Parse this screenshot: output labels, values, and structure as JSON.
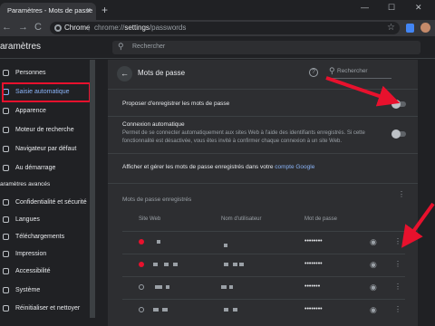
{
  "browser": {
    "tab_title": "Paramètres - Mots de passe",
    "tab_close": "×",
    "new_tab": "+",
    "win_min": "—",
    "win_max": "☐",
    "win_close": "✕",
    "omnibox_site": "Chrome",
    "omnibox_sep": "|",
    "omnibox_url_prefix": "chrome://",
    "omnibox_url_path": "settings",
    "omnibox_url_suffix": "/passwords",
    "back": "←",
    "forward": "→",
    "reload": "C",
    "star": "☆"
  },
  "header": {
    "title": "aramètres",
    "search_placeholder": "Rechercher"
  },
  "sidebar": {
    "items": [
      {
        "label": "Personnes",
        "icon": "person-icon"
      },
      {
        "label": "Saisie automatique",
        "icon": "autofill-icon",
        "active": true
      },
      {
        "label": "Apparence",
        "icon": "palette-icon"
      },
      {
        "label": "Moteur de recherche",
        "icon": "search-engine-icon"
      },
      {
        "label": "Navigateur par défaut",
        "icon": "browser-icon"
      },
      {
        "label": "Au démarrage",
        "icon": "power-icon"
      }
    ],
    "section_label": "aramètres avancés",
    "advanced_items": [
      {
        "label": "Confidentialité et sécurité",
        "icon": "shield-icon"
      },
      {
        "label": "Langues",
        "icon": "globe-icon"
      },
      {
        "label": "Téléchargements",
        "icon": "download-icon"
      },
      {
        "label": "Impression",
        "icon": "printer-icon"
      },
      {
        "label": "Accessibilité",
        "icon": "accessibility-icon"
      },
      {
        "label": "Système",
        "icon": "wrench-icon"
      },
      {
        "label": "Réinitialiser et nettoyer",
        "icon": "reset-icon"
      }
    ]
  },
  "main": {
    "back_icon": "←",
    "title": "Mots de passe",
    "help_icon": "?",
    "search_placeholder": "Rechercher",
    "offer_to_save": {
      "label": "Proposer d'enregistrer les mots de passe",
      "enabled": false
    },
    "auto_signin": {
      "label": "Connexion automatique",
      "description": "Permet de se connecter automatiquement aux sites Web à l'aide des identifiants enregistrés. Si cette fonctionnalité est désactivée, vous êtes invité à confirmer chaque connexion à un site Web.",
      "enabled": false
    },
    "manage_text": "Afficher et gérer les mots de passe enregistrés dans votre",
    "manage_link": "compte Google",
    "saved_title": "Mots de passe enregistrés",
    "kebab": "⋮",
    "columns": [
      "Site Web",
      "Nom d'utilisateur",
      "Mot de passe"
    ],
    "rows": [
      {
        "favicon": "google-favicon",
        "password": "••••••••"
      },
      {
        "favicon": "google-favicon",
        "password": "••••••••"
      },
      {
        "favicon": "globe-favicon",
        "password": "•••••••"
      },
      {
        "favicon": "globe-favicon",
        "password": "••••••••"
      }
    ],
    "eye_icon": "◉",
    "row_kebab": "⋮"
  },
  "annotations": {
    "arrow_color": "#e8112d",
    "highlight_color": "#e8112d"
  }
}
